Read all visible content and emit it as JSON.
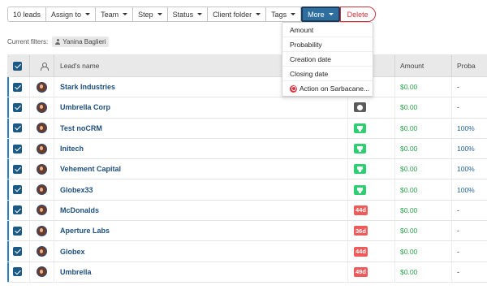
{
  "toolbar": {
    "leads_count": "10 leads",
    "assign_to": "Assign to",
    "team": "Team",
    "step": "Step",
    "status": "Status",
    "client_folder": "Client folder",
    "tags": "Tags",
    "more": "More",
    "delete": "Delete"
  },
  "filters": {
    "label": "Current filters:",
    "chip": "Yanina Baglieri"
  },
  "table": {
    "headers": {
      "lead_name": "Lead's name",
      "amount": "Amount",
      "proba": "Proba"
    },
    "rows": [
      {
        "name": "Stark Industries",
        "badge": "",
        "badge_type": "none",
        "amount": "$0.00",
        "proba": "-"
      },
      {
        "name": "Umbrella Corp",
        "badge": "",
        "badge_type": "grey",
        "amount": "$0.00",
        "proba": "-"
      },
      {
        "name": "Test noCRM",
        "badge": "",
        "badge_type": "green",
        "amount": "$0.00",
        "proba": "100%"
      },
      {
        "name": "Initech",
        "badge": "",
        "badge_type": "green",
        "amount": "$0.00",
        "proba": "100%"
      },
      {
        "name": "Vehement Capital",
        "badge": "",
        "badge_type": "green",
        "amount": "$0.00",
        "proba": "100%"
      },
      {
        "name": "Globex33",
        "badge": "",
        "badge_type": "green",
        "amount": "$0.00",
        "proba": "100%"
      },
      {
        "name": "McDonalds",
        "badge": "44d",
        "badge_type": "red",
        "amount": "$0.00",
        "proba": "-"
      },
      {
        "name": "Aperture Labs",
        "badge": "36d",
        "badge_type": "red",
        "amount": "$0.00",
        "proba": "-"
      },
      {
        "name": "Globex",
        "badge": "44d",
        "badge_type": "red",
        "amount": "$0.00",
        "proba": "-"
      },
      {
        "name": "Umbrella",
        "badge": "49d",
        "badge_type": "red",
        "amount": "$0.00",
        "proba": "-"
      }
    ]
  },
  "dropdown": {
    "items": [
      "Amount",
      "Probability",
      "Creation date",
      "Closing date",
      "Action on Sarbacane..."
    ]
  },
  "colors": {
    "accent": "#2f6fa0",
    "checkbox": "#1c5a86",
    "lead_link": "#1e4f80",
    "amount_green": "#2aa14a",
    "delete_red": "#d0343e",
    "overdue_red": "#ef5b5b",
    "won_green": "#2ecf71"
  }
}
